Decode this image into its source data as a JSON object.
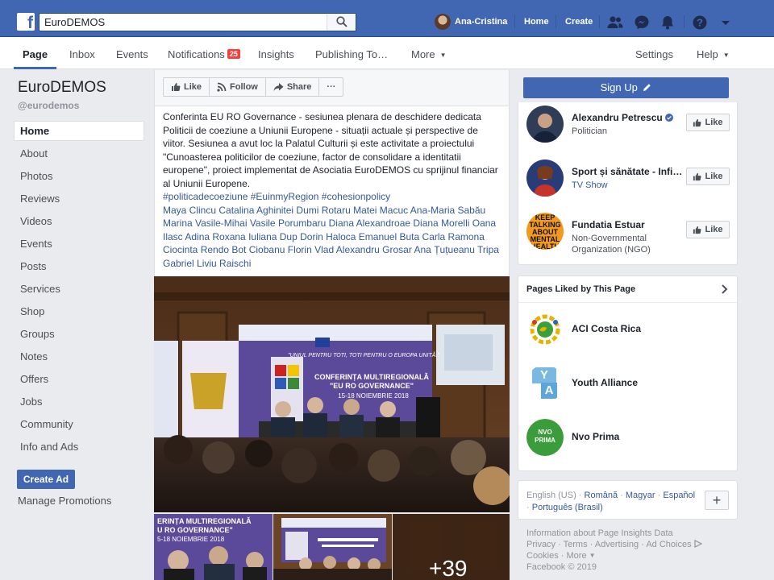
{
  "topbar": {
    "search_value": "EuroDEMOS",
    "profile_name": "Ana-Cristina",
    "home_label": "Home",
    "create_label": "Create"
  },
  "pagenav": {
    "tabs": [
      {
        "label": "Page"
      },
      {
        "label": "Inbox"
      },
      {
        "label": "Events"
      },
      {
        "label": "Notifications",
        "badge": "25"
      },
      {
        "label": "Insights"
      },
      {
        "label": "Publishing To…"
      },
      {
        "label": "More"
      }
    ],
    "settings_label": "Settings",
    "help_label": "Help"
  },
  "sidebar": {
    "page_name": "EuroDEMOS",
    "page_handle": "@eurodemos",
    "items": [
      {
        "label": "Home"
      },
      {
        "label": "About"
      },
      {
        "label": "Photos"
      },
      {
        "label": "Reviews"
      },
      {
        "label": "Videos"
      },
      {
        "label": "Events"
      },
      {
        "label": "Posts"
      },
      {
        "label": "Services"
      },
      {
        "label": "Shop"
      },
      {
        "label": "Groups"
      },
      {
        "label": "Notes"
      },
      {
        "label": "Offers"
      },
      {
        "label": "Jobs"
      },
      {
        "label": "Community"
      },
      {
        "label": "Info and Ads"
      }
    ],
    "create_ad_label": "Create Ad",
    "manage_promotions_label": "Manage Promotions"
  },
  "actions": {
    "like_label": "Like",
    "follow_label": "Follow",
    "share_label": "Share",
    "more_label": "···"
  },
  "post": {
    "text": "Conferinta EU RO Governance - sesiunea plenara de deschidere dedicata Politicii de coeziune a Uniunii Europene - situații actuale și perspective de viitor. Sesiunea a avut loc la Palatul Culturii și este activitate a proiectului \"Cunoasterea politicilor de coeziune, factor de consolidare a identitatii europene\", proiect implementat de Asociatia EuroDEMOS cu sprijinul financiar al Uniunii Europene.",
    "hashtags": "#politicadecoeziune #EuinmyRegion #cohesionpolicy",
    "tagged": "Maya Clincu Catalina Aghinitei Dumi Rotaru Matei Macuc Ana-Maria Sabău Marina Vasile-Mihai Vasile Porumbaru Diana Alexandroae Diana Morelli Oana Ilasc Adina Roxana Iuliana Dup Dorin Haloca Emanuel Buta Carla Ramona Ciocinta Rendo Bot Ciobanu Florin Vlad Alexandru Grosar Ana Țuțueanu Tripa Gabriel Liviu Raischi",
    "photo_banner_line1": "\"UNIUL PENTRU TOTI, TOTI PENTRU O EUROPA UNITĂ.\"",
    "photo_banner_line2": "CONFERINȚA MULTIREGIONALĂ",
    "photo_banner_line3": "\"EU RO GOVERNANCE\"",
    "photo_banner_line4": "15-18 NOIEMBRIE 2018",
    "strip1_line1": "ERINȚA MULTIREGIONALĂ",
    "strip1_line2": "U RO GOVERNANCE\"",
    "strip1_line3": "5-18 NOIEMBRIE 2018",
    "more_photos": "+39"
  },
  "right": {
    "signup_label": "Sign Up",
    "suggested": [
      {
        "title": "Alexandru Petrescu",
        "sub": "Politician",
        "verified": true,
        "like": "Like"
      },
      {
        "title": "Sport și sănătate - Infi…",
        "sub": "TV Show",
        "link": true,
        "like": "Like"
      },
      {
        "title": "Fundatia Estuar",
        "sub": "Non-Governmental Organization (NGO)",
        "like": "Like",
        "logo_text": "KEEP TALKING ABOUT MENTAL HEALTH"
      }
    ],
    "liked_heading": "Pages Liked by This Page",
    "liked": [
      {
        "title": "ACI Costa Rica",
        "logo": "aci"
      },
      {
        "title": "Youth Alliance",
        "logo_letters": [
          "Y",
          "A"
        ]
      },
      {
        "title": "Nvo Prima",
        "logo_text": "NVO PRIMA"
      }
    ],
    "languages": {
      "current": "English (US)",
      "others": [
        "Română",
        "Magyar",
        "Español",
        "Português (Brasil)"
      ]
    },
    "footer": {
      "line1": "Information about Page Insights Data",
      "line2": "Privacy · Terms · Advertising · Ad Choices",
      "line3": "Cookies · More",
      "line4": "Facebook © 2019"
    }
  },
  "colors": {
    "brand_blue": "#4267b2",
    "link_blue": "#365899",
    "badge_red": "#fa3e3e"
  }
}
